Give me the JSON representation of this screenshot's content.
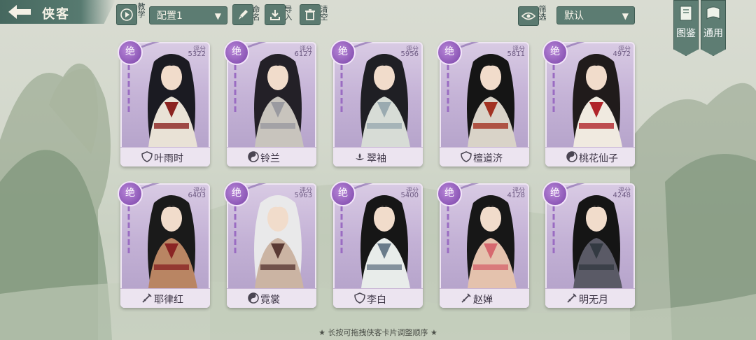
{
  "header": {
    "title": "侠客",
    "tutorial_label": "教学",
    "config_select": "配置1",
    "rename_label": "命名",
    "import_label": "导入",
    "clear_label": "清空",
    "filter_label": "筛选",
    "sort_select": "默认",
    "atlas_label": "图鉴",
    "general_label": "通用"
  },
  "cards_row1": [
    {
      "rank": "绝",
      "score_label": "评分",
      "score": "5322",
      "name": "叶雨时",
      "faction_icon": "shield-icon"
    },
    {
      "rank": "绝",
      "score_label": "评分",
      "score": "6127",
      "name": "铃兰",
      "faction_icon": "yin-yang-icon"
    },
    {
      "rank": "绝",
      "score_label": "评分",
      "score": "5956",
      "name": "翠袖",
      "faction_icon": "lotus-icon"
    },
    {
      "rank": "绝",
      "score_label": "评分",
      "score": "5811",
      "name": "檀道济",
      "faction_icon": "shield-icon"
    },
    {
      "rank": "绝",
      "score_label": "评分",
      "score": "4972",
      "name": "桃花仙子",
      "faction_icon": "yin-yang-icon"
    }
  ],
  "cards_row2": [
    {
      "rank": "绝",
      "score_label": "评分",
      "score": "6403",
      "name": "耶律红",
      "faction_icon": "sword-icon"
    },
    {
      "rank": "绝",
      "score_label": "评分",
      "score": "5963",
      "name": "霓裳",
      "faction_icon": "yin-yang-icon"
    },
    {
      "rank": "绝",
      "score_label": "评分",
      "score": "5400",
      "name": "李白",
      "faction_icon": "shield-icon"
    },
    {
      "rank": "绝",
      "score_label": "评分",
      "score": "4128",
      "name": "赵婵",
      "faction_icon": "sword-icon"
    },
    {
      "rank": "绝",
      "score_label": "评分",
      "score": "4248",
      "name": "明无月",
      "faction_icon": "sword-icon"
    }
  ],
  "footer_hint": "★ 长按可拖拽侠客卡片调整顺序 ★",
  "colors": {
    "accent": "#5b7a70",
    "card_purple": "#c4b2d6",
    "rank_purple": "#7a44a8"
  }
}
